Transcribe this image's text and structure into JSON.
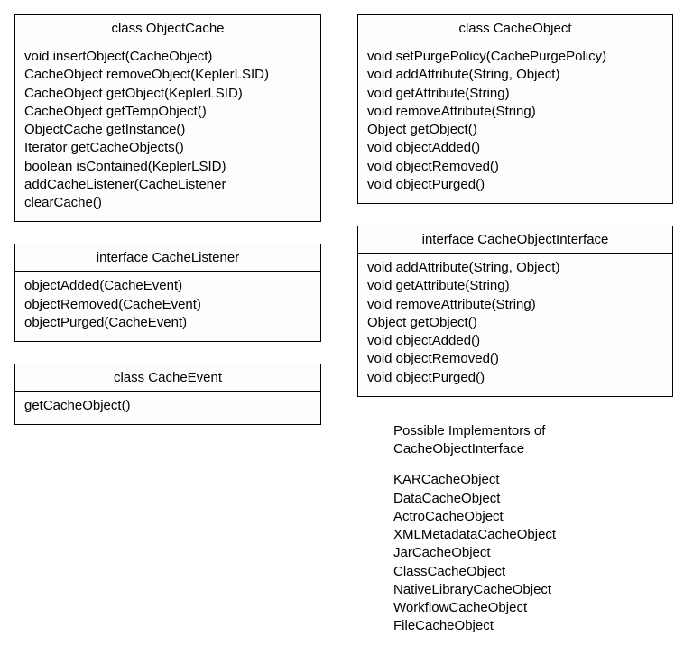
{
  "left": {
    "objectCache": {
      "title": "class ObjectCache",
      "methods": [
        "void insertObject(CacheObject)",
        "CacheObject removeObject(KeplerLSID)",
        "CacheObject getObject(KeplerLSID)",
        "CacheObject getTempObject()",
        "ObjectCache getInstance()",
        "Iterator getCacheObjects()",
        "boolean isContained(KeplerLSID)",
        "addCacheListener(CacheListener",
        "clearCache()"
      ]
    },
    "cacheListener": {
      "title": "interface CacheListener",
      "methods": [
        "objectAdded(CacheEvent)",
        "objectRemoved(CacheEvent)",
        "objectPurged(CacheEvent)"
      ]
    },
    "cacheEvent": {
      "title": "class CacheEvent",
      "methods": [
        "getCacheObject()"
      ]
    }
  },
  "right": {
    "cacheObject": {
      "title": "class CacheObject",
      "methods": [
        "void setPurgePolicy(CachePurgePolicy)",
        "void addAttribute(String, Object)",
        "void getAttribute(String)",
        "void removeAttribute(String)",
        "Object getObject()",
        "void objectAdded()",
        "void objectRemoved()",
        "void objectPurged()"
      ]
    },
    "cacheObjectInterface": {
      "title": "interface CacheObjectInterface",
      "methods": [
        "void addAttribute(String, Object)",
        "void getAttribute(String)",
        "void removeAttribute(String)",
        "Object getObject()",
        "void objectAdded()",
        "void objectRemoved()",
        "void objectPurged()"
      ]
    },
    "implementorsHeading1": "Possible Implementors of",
    "implementorsHeading2": "CacheObjectInterface",
    "implementors": [
      "KARCacheObject",
      "DataCacheObject",
      "ActroCacheObject",
      "XMLMetadataCacheObject",
      "JarCacheObject",
      "ClassCacheObject",
      "NativeLibraryCacheObject",
      "WorkflowCacheObject",
      "FileCacheObject"
    ]
  }
}
